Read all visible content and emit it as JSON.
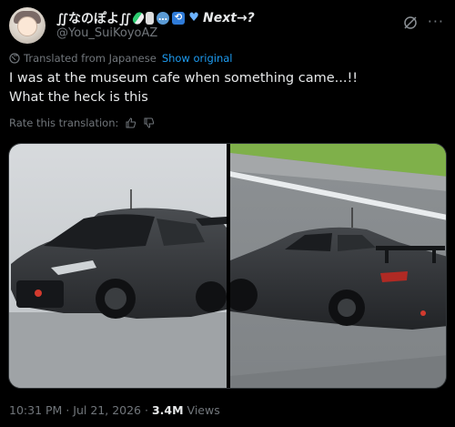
{
  "author": {
    "display_name": "∬なのぽよ∬",
    "display_name_tail": "Next→?",
    "handle": "@You_SuiKoyoAZ"
  },
  "icons": {
    "avatar": "avatar",
    "grok": "grok-icon",
    "more": "more-icon",
    "globe": "globe-icon",
    "thumbs_up": "thumbs-up-icon",
    "thumbs_down": "thumbs-down-icon"
  },
  "translation": {
    "label": "Translated from Japanese",
    "show_original": "Show original",
    "rate_label": "Rate this translation:"
  },
  "tweet": {
    "line1": "I was at the museum cafe when something came...!!",
    "line2": "What the heck is this"
  },
  "media": {
    "photos": [
      "car-front-photo",
      "car-rear-photo"
    ]
  },
  "meta": {
    "time": "10:31 PM",
    "separator": "·",
    "date": "Jul 21, 2026",
    "views_count": "3.4M",
    "views_label": "Views"
  },
  "colors": {
    "background": "#000000",
    "text": "#e7e9ea",
    "secondary": "#71767b",
    "link": "#1d9bf0"
  }
}
